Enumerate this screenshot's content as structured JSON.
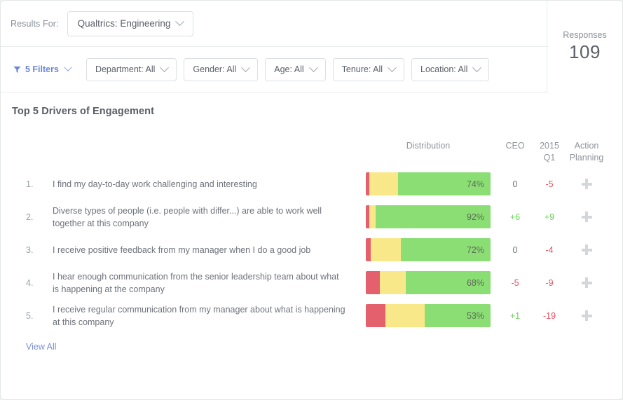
{
  "header": {
    "results_for_label": "Results For:",
    "scope_pill": {
      "label": "Qualtrics: Engineering",
      "icon": "chevron-down-icon"
    },
    "filters_button": {
      "label": "5 Filters",
      "icon": "funnel-icon",
      "count": 5,
      "color": "#6f86d6"
    },
    "filter_pills": [
      {
        "name": "department",
        "label": "Department: All",
        "prefix": "Department:",
        "value": "All"
      },
      {
        "name": "gender",
        "label": "Gender: All",
        "prefix": "Gender:",
        "value": "All"
      },
      {
        "name": "age",
        "label": "Age: All",
        "prefix": "Age:",
        "value": "All"
      },
      {
        "name": "tenure",
        "label": "Tenure: All",
        "prefix": "Tenure:",
        "value": "All"
      },
      {
        "name": "location",
        "label": "Location: All",
        "prefix": "Location:",
        "value": "All"
      }
    ],
    "responses": {
      "label": "Responses",
      "value": "109"
    }
  },
  "card": {
    "title": "Top 5 Drivers of Engagement",
    "view_all_label": "View All",
    "columns": {
      "distribution": "Distribution",
      "ceo": "CEO",
      "quarter_line1": "2015",
      "quarter_line2": "Q1",
      "action_line1": "Action",
      "action_line2": "Planning"
    },
    "action_icon": "plus-icon"
  },
  "chart_data": {
    "type": "bar",
    "title": "Top 5 Drivers of Engagement",
    "subtype": "stacked-horizontal-100pct",
    "colors": {
      "negative": "#e4606d",
      "neutral": "#f9e88a",
      "positive": "#8ade74"
    },
    "segments": [
      "negative",
      "neutral",
      "positive"
    ],
    "columns": [
      "Distribution",
      "CEO",
      "2015 Q1",
      "Action Planning"
    ],
    "xlabel": "",
    "ylabel": "",
    "xlim": [
      0,
      100
    ],
    "grid": false,
    "legend": "none",
    "rows": [
      {
        "rank": "1.",
        "question": "I find my day-to-day work challenging and interesting",
        "favorable": 74,
        "neutral": 23,
        "unfavorable": 3,
        "label": "74%",
        "ceo": "0",
        "ceo_dir": "zero",
        "quarter": "-5",
        "quarter_dir": "down"
      },
      {
        "rank": "2.",
        "question": "Diverse types of people (i.e. people with differ...) are able to work well together at this company",
        "favorable": 92,
        "neutral": 5,
        "unfavorable": 3,
        "label": "92%",
        "ceo": "+6",
        "ceo_dir": "up",
        "quarter": "+9",
        "quarter_dir": "up"
      },
      {
        "rank": "3.",
        "question": "I receive positive feedback from my manager when I do a good job",
        "favorable": 72,
        "neutral": 24,
        "unfavorable": 4,
        "label": "72%",
        "ceo": "0",
        "ceo_dir": "zero",
        "quarter": "-4",
        "quarter_dir": "down"
      },
      {
        "rank": "4.",
        "question": "I hear enough communication from the senior leadership team about what is happening at the company",
        "favorable": 68,
        "neutral": 21,
        "unfavorable": 11,
        "label": "68%",
        "ceo": "-5",
        "ceo_dir": "down",
        "quarter": "-9",
        "quarter_dir": "down"
      },
      {
        "rank": "5.",
        "question": "I receive regular communication from my manager about what is happening at this company",
        "favorable": 53,
        "neutral": 31,
        "unfavorable": 16,
        "label": "53%",
        "ceo": "+1",
        "ceo_dir": "up",
        "quarter": "-19",
        "quarter_dir": "down"
      }
    ]
  }
}
